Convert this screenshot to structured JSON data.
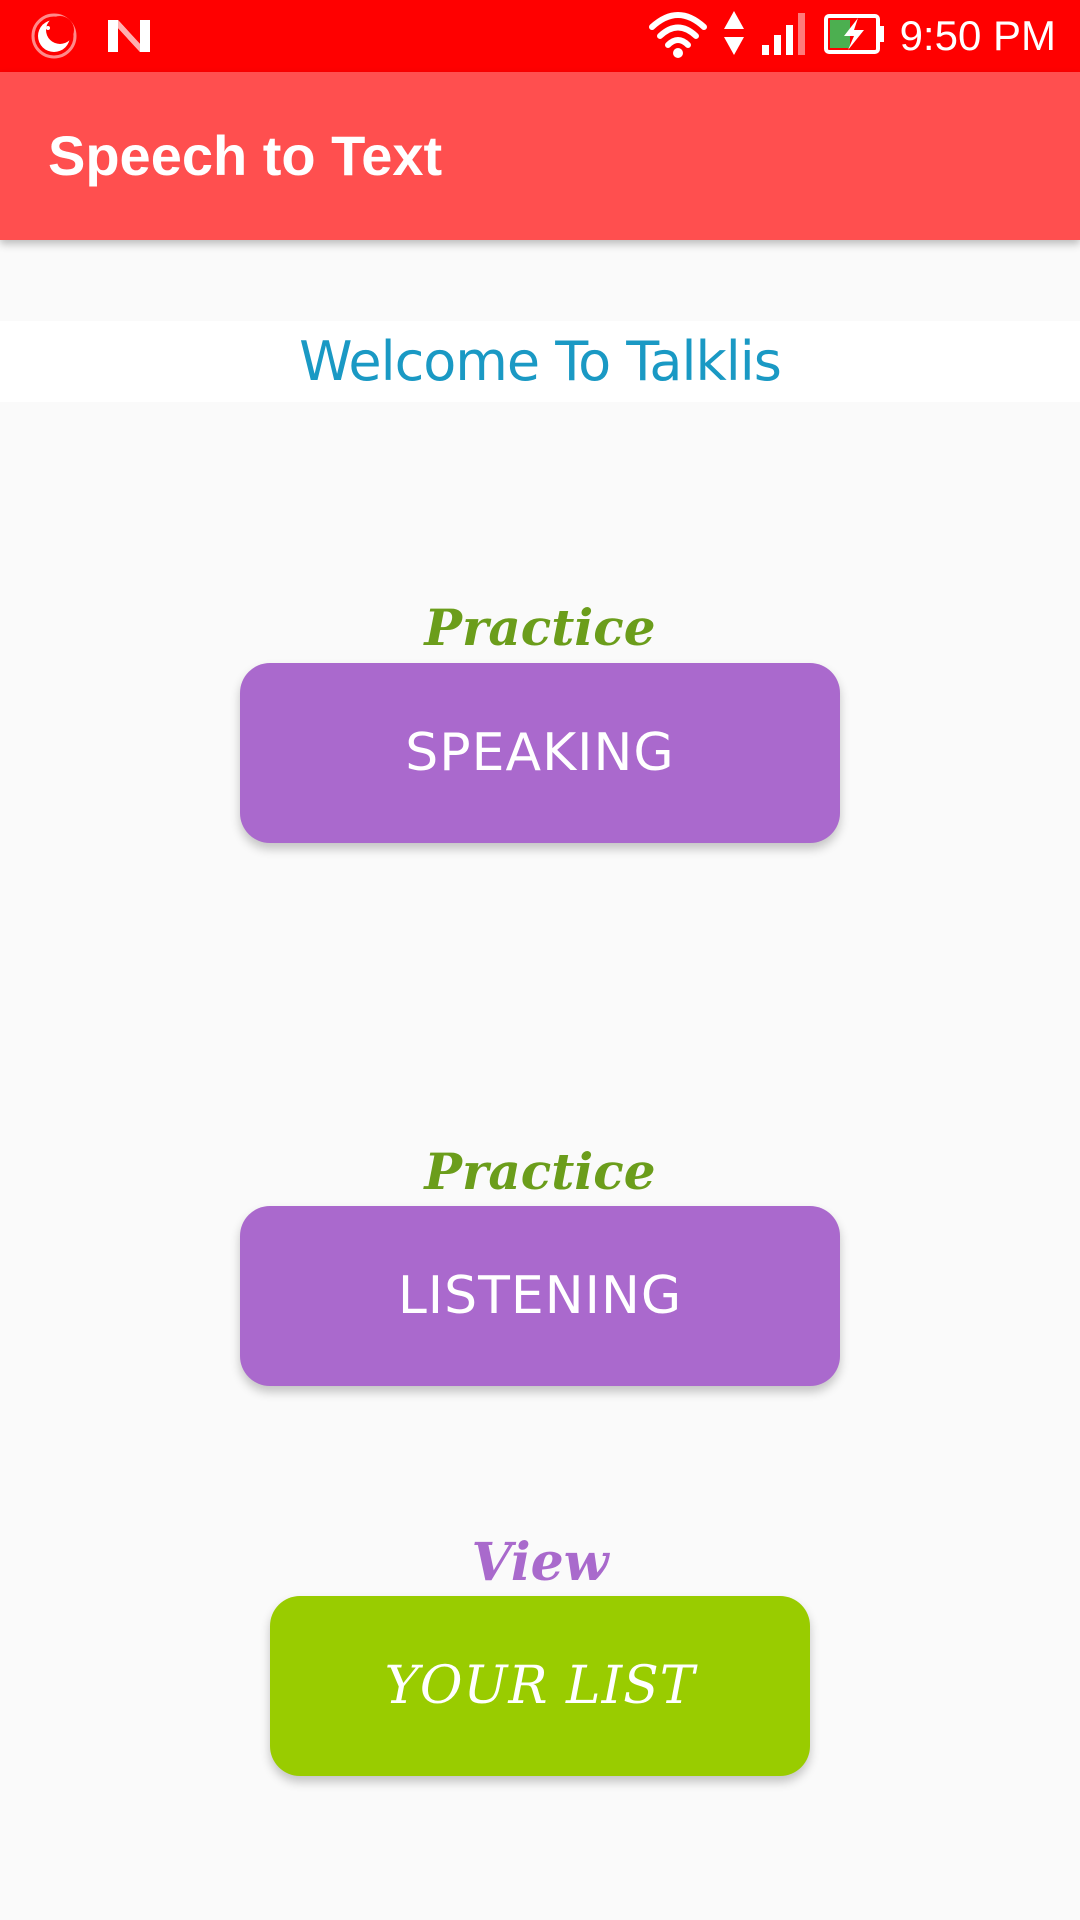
{
  "status_bar": {
    "time": "9:50 PM",
    "icons": [
      "night-mode-icon",
      "n-app-icon",
      "wifi-icon",
      "data-arrows-icon",
      "signal-icon",
      "battery-charging-icon"
    ]
  },
  "app_bar": {
    "title": "Speech to Text"
  },
  "welcome": {
    "text": "Welcome To Talklis"
  },
  "sections": [
    {
      "caption": "Practice",
      "button": "SPEAKING"
    },
    {
      "caption": "Practice",
      "button": "LISTENING"
    },
    {
      "caption": "View",
      "button": "YOUR LIST"
    }
  ],
  "colors": {
    "status_bar": "#ff0000",
    "app_bar": "#ff4f4f",
    "welcome_text": "#1a99c4",
    "caption_green": "#6b9d1b",
    "caption_purple": "#a96acc",
    "button_purple": "#aa69cd",
    "button_green": "#99cc00"
  }
}
